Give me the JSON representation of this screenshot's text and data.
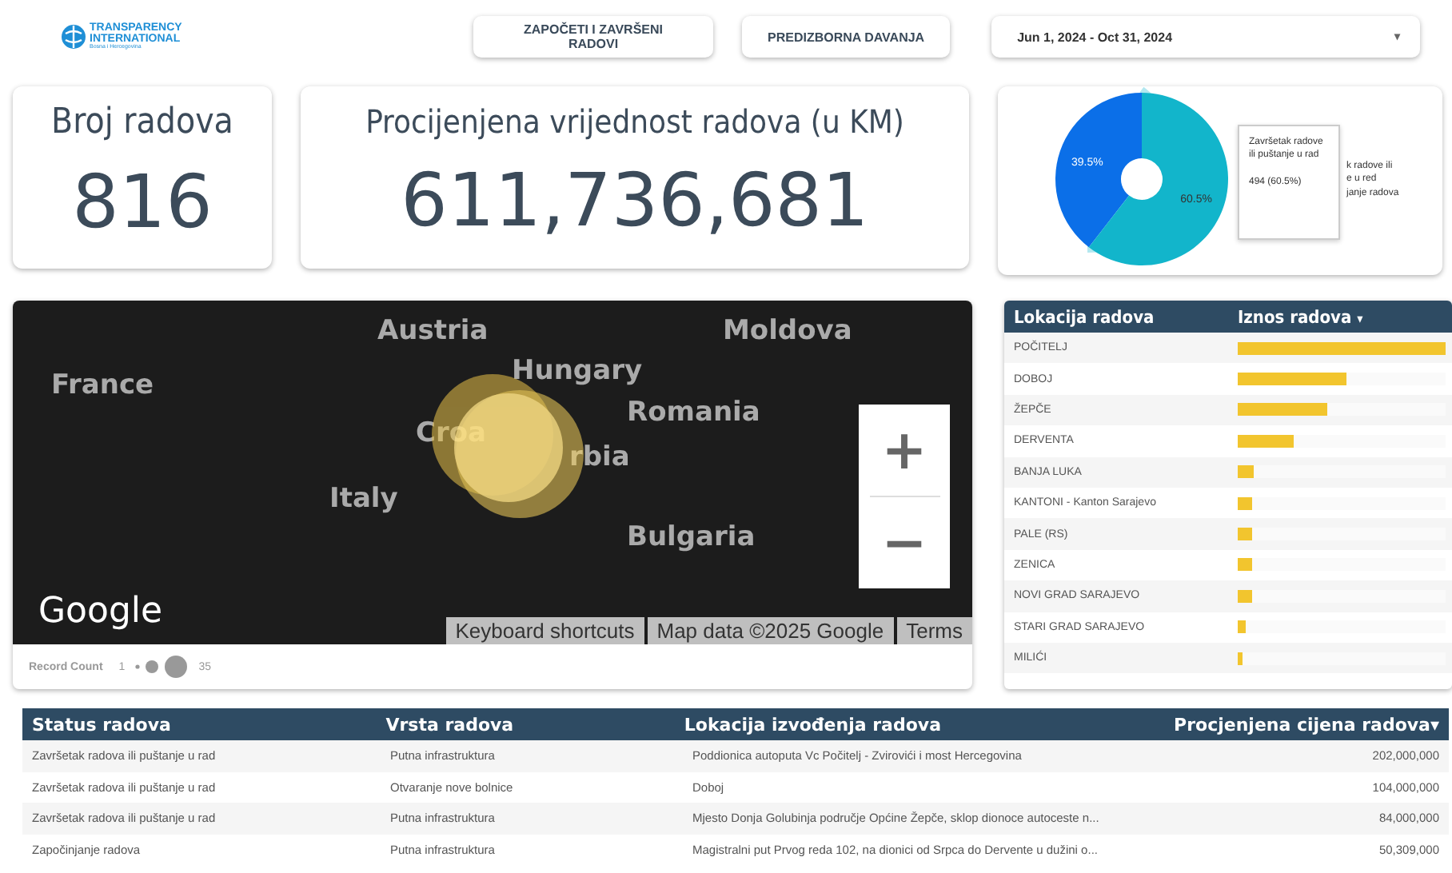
{
  "header": {
    "logo": {
      "line1": "TRANSPARENCY",
      "line2": "INTERNATIONAL",
      "line3": "Bosna i Hercegovina"
    },
    "nav_buttons": [
      {
        "label": "ZAPOČETI I ZAVRŠENI RADOVI"
      },
      {
        "label": "PREDIZBORNA DAVANJA"
      }
    ],
    "date_range": {
      "value": "Jun 1, 2024 - Oct 31, 2024",
      "caret": "▾"
    }
  },
  "kpis": [
    {
      "label": "Broj radova",
      "value": "816"
    },
    {
      "label": "Procijenjena vrijednost radova (u KM)",
      "value": "611,736,681"
    }
  ],
  "donut": {
    "chart_data": {
      "type": "donut",
      "values": [
        39.5,
        60.5
      ],
      "value_labels": [
        "39.5%",
        "60.5%"
      ]
    },
    "slices": [
      {
        "color": "#0b6fe8"
      },
      {
        "color": "#12b5cb"
      }
    ],
    "legend_fragments": [
      "k radove ili",
      "e u red",
      "janje radova"
    ],
    "tooltip": {
      "title": "Završetak radove ili puštanje u rad",
      "value": "494 (60.5%)"
    }
  },
  "map": {
    "labels": [
      "Austria",
      "Moldova",
      "France",
      "Hungary",
      "Romania",
      "Croa",
      "rbia",
      "Italy",
      "Bulgaria"
    ],
    "zoom_in": "+",
    "zoom_out": "−",
    "logo": "Google",
    "attribution": [
      "Keyboard shortcuts",
      "Map data ©2025 Google",
      "Terms"
    ],
    "legend": {
      "title": "Record Count",
      "min": "1",
      "max": "35"
    }
  },
  "location_table": {
    "columns": [
      "Lokacija radova",
      "Iznos radova"
    ],
    "sort_caret": "▾",
    "rows": [
      {
        "name": "POČITELJ",
        "level": 1.0
      },
      {
        "name": "DOBOJ",
        "level": 0.52
      },
      {
        "name": "ŽEPČE",
        "level": 0.43
      },
      {
        "name": "DERVENTA",
        "level": 0.27
      },
      {
        "name": "BANJA LUKA",
        "level": 0.08
      },
      {
        "name": "KANTONI - Kanton Sarajevo",
        "level": 0.07
      },
      {
        "name": "PALE (RS)",
        "level": 0.07
      },
      {
        "name": "ZENICA",
        "level": 0.07
      },
      {
        "name": "NOVI GRAD SARAJEVO",
        "level": 0.07
      },
      {
        "name": "STARI GRAD SARAJEVO",
        "level": 0.04
      },
      {
        "name": "MILIĆI",
        "level": 0.02
      }
    ]
  },
  "works_table": {
    "columns": [
      "Status radova",
      "Vrsta radova",
      "Lokacija izvođenja radova",
      "Procjenjena cijena radova"
    ],
    "sort_caret": "▾",
    "rows": [
      [
        "Završetak radova ili puštanje u rad",
        "Putna infrastruktura",
        "Poddionica autoputa Vc Počitelj - Zvirovići i most Hercegovina",
        "202,000,000"
      ],
      [
        "Završetak radova ili puštanje u rad",
        "Otvaranje nove bolnice",
        "Doboj",
        "104,000,000"
      ],
      [
        "Završetak radova ili puštanje u rad",
        "Putna infrastruktura",
        "Mjesto Donja Golubinja područje Općine Žepče, sklop dionoce autoceste n...",
        "84,000,000"
      ],
      [
        "Započinjanje radova",
        "Putna infrastruktura",
        "Magistralni put Prvog reda 102, na dionici od Srpca do Dervente u dužini o...",
        "50,309,000"
      ]
    ]
  }
}
